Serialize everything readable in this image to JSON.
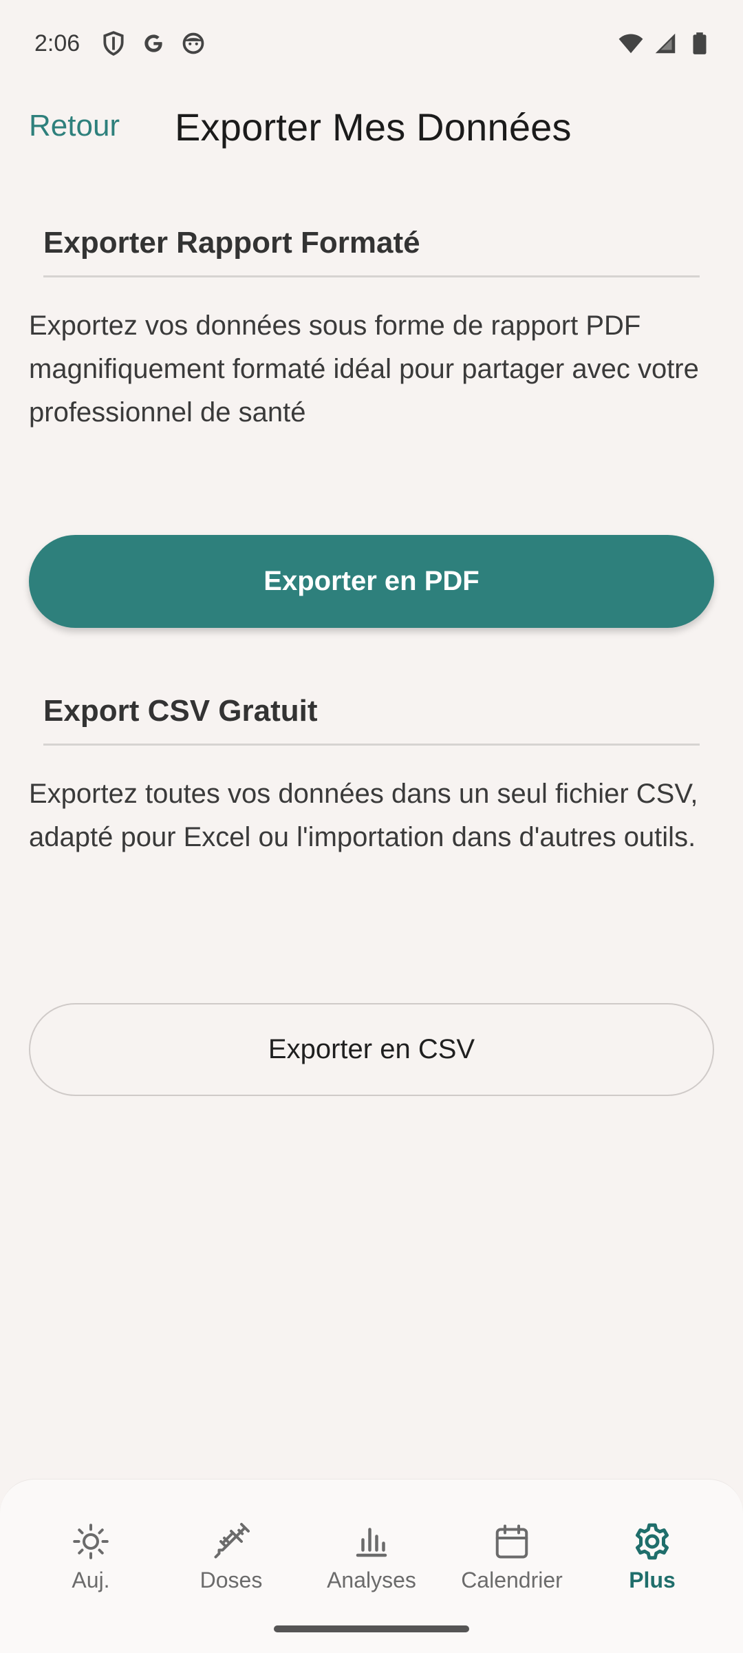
{
  "status_bar": {
    "time": "2:06",
    "left_icons": [
      "shield-icon",
      "google-icon",
      "face-icon"
    ],
    "right_icons": [
      "wifi-icon",
      "signal-icon",
      "battery-icon"
    ]
  },
  "header": {
    "back_label": "Retour",
    "title": "Exporter Mes Données"
  },
  "sections": [
    {
      "heading": "Exporter Rapport Formaté",
      "description": "Exportez vos données sous forme de rapport PDF magnifiquement formaté idéal pour partager avec votre professionnel de santé",
      "button_label": "Exporter en PDF"
    },
    {
      "heading": "Export CSV Gratuit",
      "description": "Exportez toutes vos données dans un seul fichier CSV, adapté pour Excel ou l'importation dans d'autres outils.",
      "button_label": "Exporter en CSV"
    }
  ],
  "bottom_nav": {
    "items": [
      {
        "label": "Auj.",
        "icon": "sun-icon",
        "active": false
      },
      {
        "label": "Doses",
        "icon": "syringe-icon",
        "active": false
      },
      {
        "label": "Analyses",
        "icon": "bar-chart-icon",
        "active": false
      },
      {
        "label": "Calendrier",
        "icon": "calendar-icon",
        "active": false
      },
      {
        "label": "Plus",
        "icon": "gear-icon",
        "active": true
      }
    ]
  },
  "colors": {
    "accent": "#2e807c",
    "background": "#f7f3f1",
    "nav_active": "#1f6e6b"
  }
}
